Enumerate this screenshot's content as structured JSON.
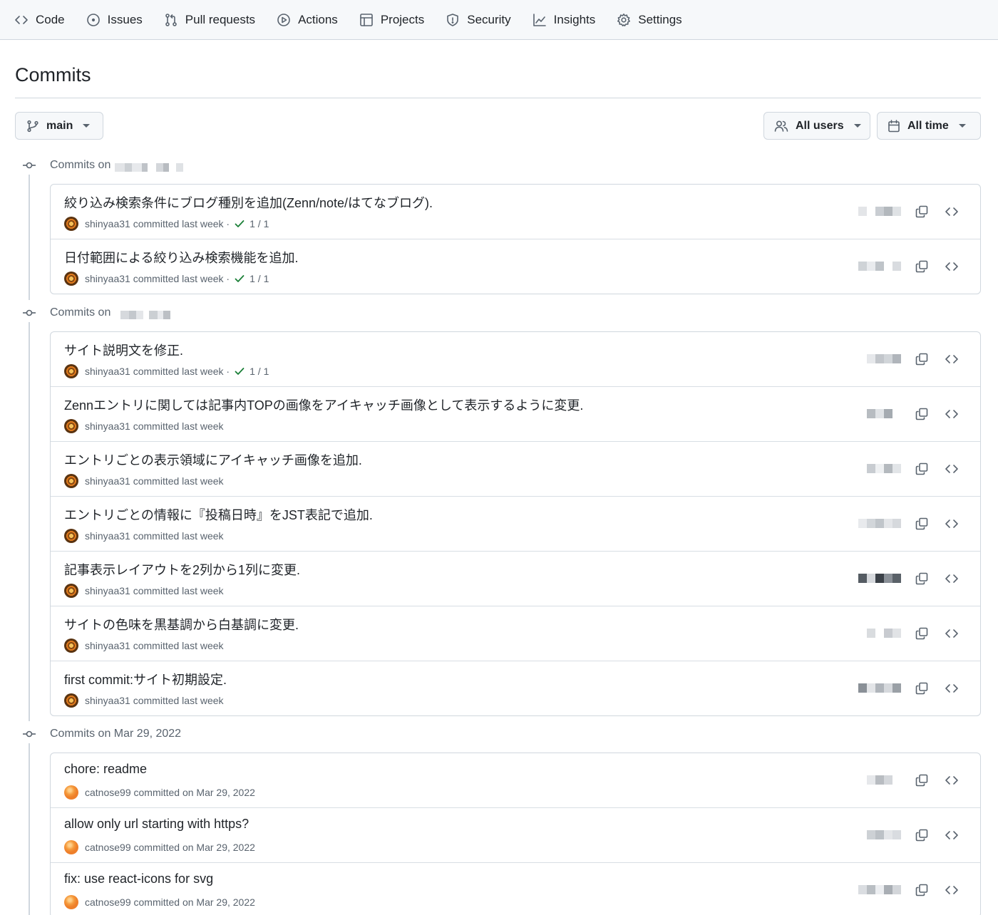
{
  "nav": {
    "items": [
      {
        "label": "Code",
        "icon": "code-icon"
      },
      {
        "label": "Issues",
        "icon": "issue-opened-icon"
      },
      {
        "label": "Pull requests",
        "icon": "git-pull-request-icon"
      },
      {
        "label": "Actions",
        "icon": "play-icon"
      },
      {
        "label": "Projects",
        "icon": "table-icon"
      },
      {
        "label": "Security",
        "icon": "shield-icon"
      },
      {
        "label": "Insights",
        "icon": "graph-icon"
      },
      {
        "label": "Settings",
        "icon": "gear-icon"
      }
    ]
  },
  "page": {
    "title": "Commits"
  },
  "filters": {
    "branch": "main",
    "users": "All users",
    "time": "All time"
  },
  "groups": [
    {
      "heading": "Commits on",
      "date_redacted": true,
      "commits": [
        {
          "message": "絞り込み検索条件にブログ種別を追加(Zenn/note/はてなブログ).",
          "author": "shinyaa31",
          "meta": "committed last week",
          "avatar": "a",
          "checks": "1 / 1"
        },
        {
          "message": "日付範囲による絞り込み検索機能を追加.",
          "author": "shinyaa31",
          "meta": "committed last week",
          "avatar": "a",
          "checks": "1 / 1"
        }
      ]
    },
    {
      "heading": "Commits on",
      "date_redacted": true,
      "commits": [
        {
          "message": "サイト説明文を修正.",
          "author": "shinyaa31",
          "meta": "committed last week",
          "avatar": "a",
          "checks": "1 / 1"
        },
        {
          "message": "Zennエントリに関しては記事内TOPの画像をアイキャッチ画像として表示するように変更.",
          "author": "shinyaa31",
          "meta": "committed last week",
          "avatar": "a",
          "checks": ""
        },
        {
          "message": "エントリごとの表示領域にアイキャッチ画像を追加.",
          "author": "shinyaa31",
          "meta": "committed last week",
          "avatar": "a",
          "checks": ""
        },
        {
          "message": "エントリごとの情報に『投稿日時』をJST表記で追加.",
          "author": "shinyaa31",
          "meta": "committed last week",
          "avatar": "a",
          "checks": ""
        },
        {
          "message": "記事表示レイアウトを2列から1列に変更.",
          "author": "shinyaa31",
          "meta": "committed last week",
          "avatar": "a",
          "checks": ""
        },
        {
          "message": "サイトの色味を黒基調から白基調に変更.",
          "author": "shinyaa31",
          "meta": "committed last week",
          "avatar": "a",
          "checks": ""
        },
        {
          "message": "first commit:サイト初期設定.",
          "author": "shinyaa31",
          "meta": "committed last week",
          "avatar": "a",
          "checks": ""
        }
      ]
    },
    {
      "heading": "Commits on Mar 29, 2022",
      "date_redacted": false,
      "commits": [
        {
          "message": "chore: readme",
          "author": "catnose99",
          "meta": "committed on Mar 29, 2022",
          "avatar": "b",
          "checks": ""
        },
        {
          "message": "allow only url starting with https?",
          "author": "catnose99",
          "meta": "committed on Mar 29, 2022",
          "avatar": "b",
          "checks": ""
        },
        {
          "message": "fix: use react-icons for svg",
          "author": "catnose99",
          "meta": "committed on Mar 29, 2022",
          "avatar": "b",
          "checks": ""
        }
      ]
    }
  ],
  "colors": {
    "text": "#1f2328",
    "muted": "#59636e",
    "border": "#d0d7de",
    "success": "#1a7f37",
    "nav_bg": "#f6f8fa"
  }
}
